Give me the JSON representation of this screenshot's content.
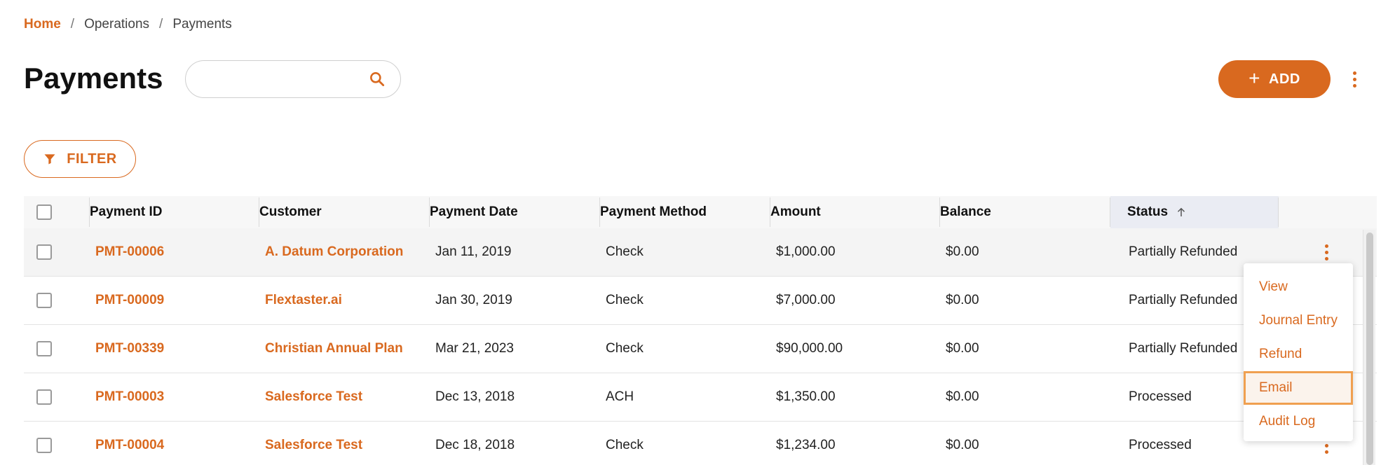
{
  "breadcrumb": {
    "home": "Home",
    "separator": "/",
    "items": [
      "Operations",
      "Payments"
    ]
  },
  "page": {
    "title": "Payments"
  },
  "search": {
    "placeholder": "",
    "value": ""
  },
  "toolbar": {
    "add_label": "ADD",
    "add_icon": "+",
    "filter_label": "FILTER"
  },
  "table": {
    "columns": [
      "Payment ID",
      "Customer",
      "Payment Date",
      "Payment Method",
      "Amount",
      "Balance",
      "Status"
    ],
    "sorted_column": "Status",
    "sort_direction": "ascending",
    "rows": [
      {
        "id": "PMT-00006",
        "customer": "A. Datum Corporation",
        "date": "Jan 11, 2019",
        "method": "Check",
        "amount": "$1,000.00",
        "balance": "$0.00",
        "status": "Partially Refunded"
      },
      {
        "id": "PMT-00009",
        "customer": "Flextaster.ai",
        "date": "Jan 30, 2019",
        "method": "Check",
        "amount": "$7,000.00",
        "balance": "$0.00",
        "status": "Partially Refunded"
      },
      {
        "id": "PMT-00339",
        "customer": "Christian Annual Plan",
        "date": "Mar 21, 2023",
        "method": "Check",
        "amount": "$90,000.00",
        "balance": "$0.00",
        "status": "Partially Refunded"
      },
      {
        "id": "PMT-00003",
        "customer": "Salesforce Test",
        "date": "Dec 13, 2018",
        "method": "ACH",
        "amount": "$1,350.00",
        "balance": "$0.00",
        "status": "Processed"
      },
      {
        "id": "PMT-00004",
        "customer": "Salesforce Test",
        "date": "Dec 18, 2018",
        "method": "Check",
        "amount": "$1,234.00",
        "balance": "$0.00",
        "status": "Processed"
      }
    ]
  },
  "row_menu": {
    "items": [
      "View",
      "Journal Entry",
      "Refund",
      "Email",
      "Audit Log"
    ],
    "focused": "Email"
  },
  "colors": {
    "accent": "#d9691f",
    "header_bg": "#f7f7f7",
    "sorted_header_bg": "#eaecf3"
  }
}
